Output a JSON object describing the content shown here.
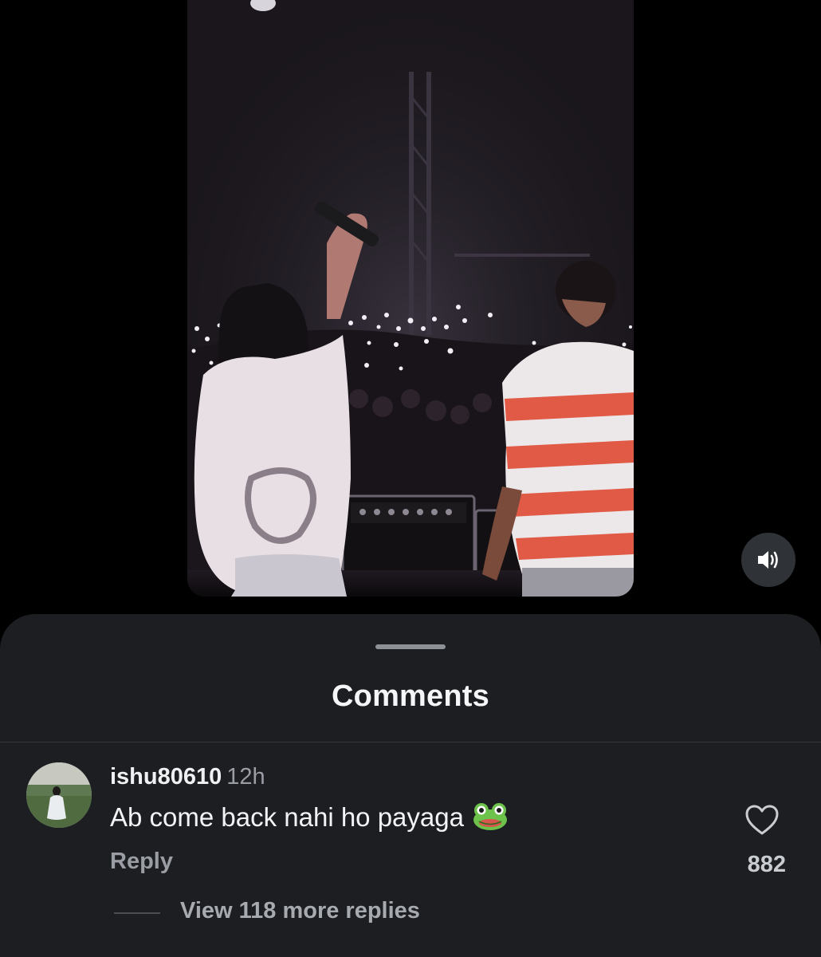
{
  "reel": {
    "media_icon": "concert-video",
    "mute_icon": "volume-on-icon"
  },
  "comments": {
    "title": "Comments",
    "items": [
      {
        "username": "ishu80610",
        "time": "12h",
        "text": "Ab come back nahi ho payaga",
        "emoji": "frog",
        "reply_label": "Reply",
        "likes": "882",
        "like_icon": "heart-outline-icon",
        "view_replies_label": "View 118 more replies"
      }
    ]
  },
  "colors": {
    "background": "#000000",
    "sheet": "#1c1e21",
    "primary_text": "#f2f3f5",
    "secondary_text": "#9a9ea4"
  }
}
